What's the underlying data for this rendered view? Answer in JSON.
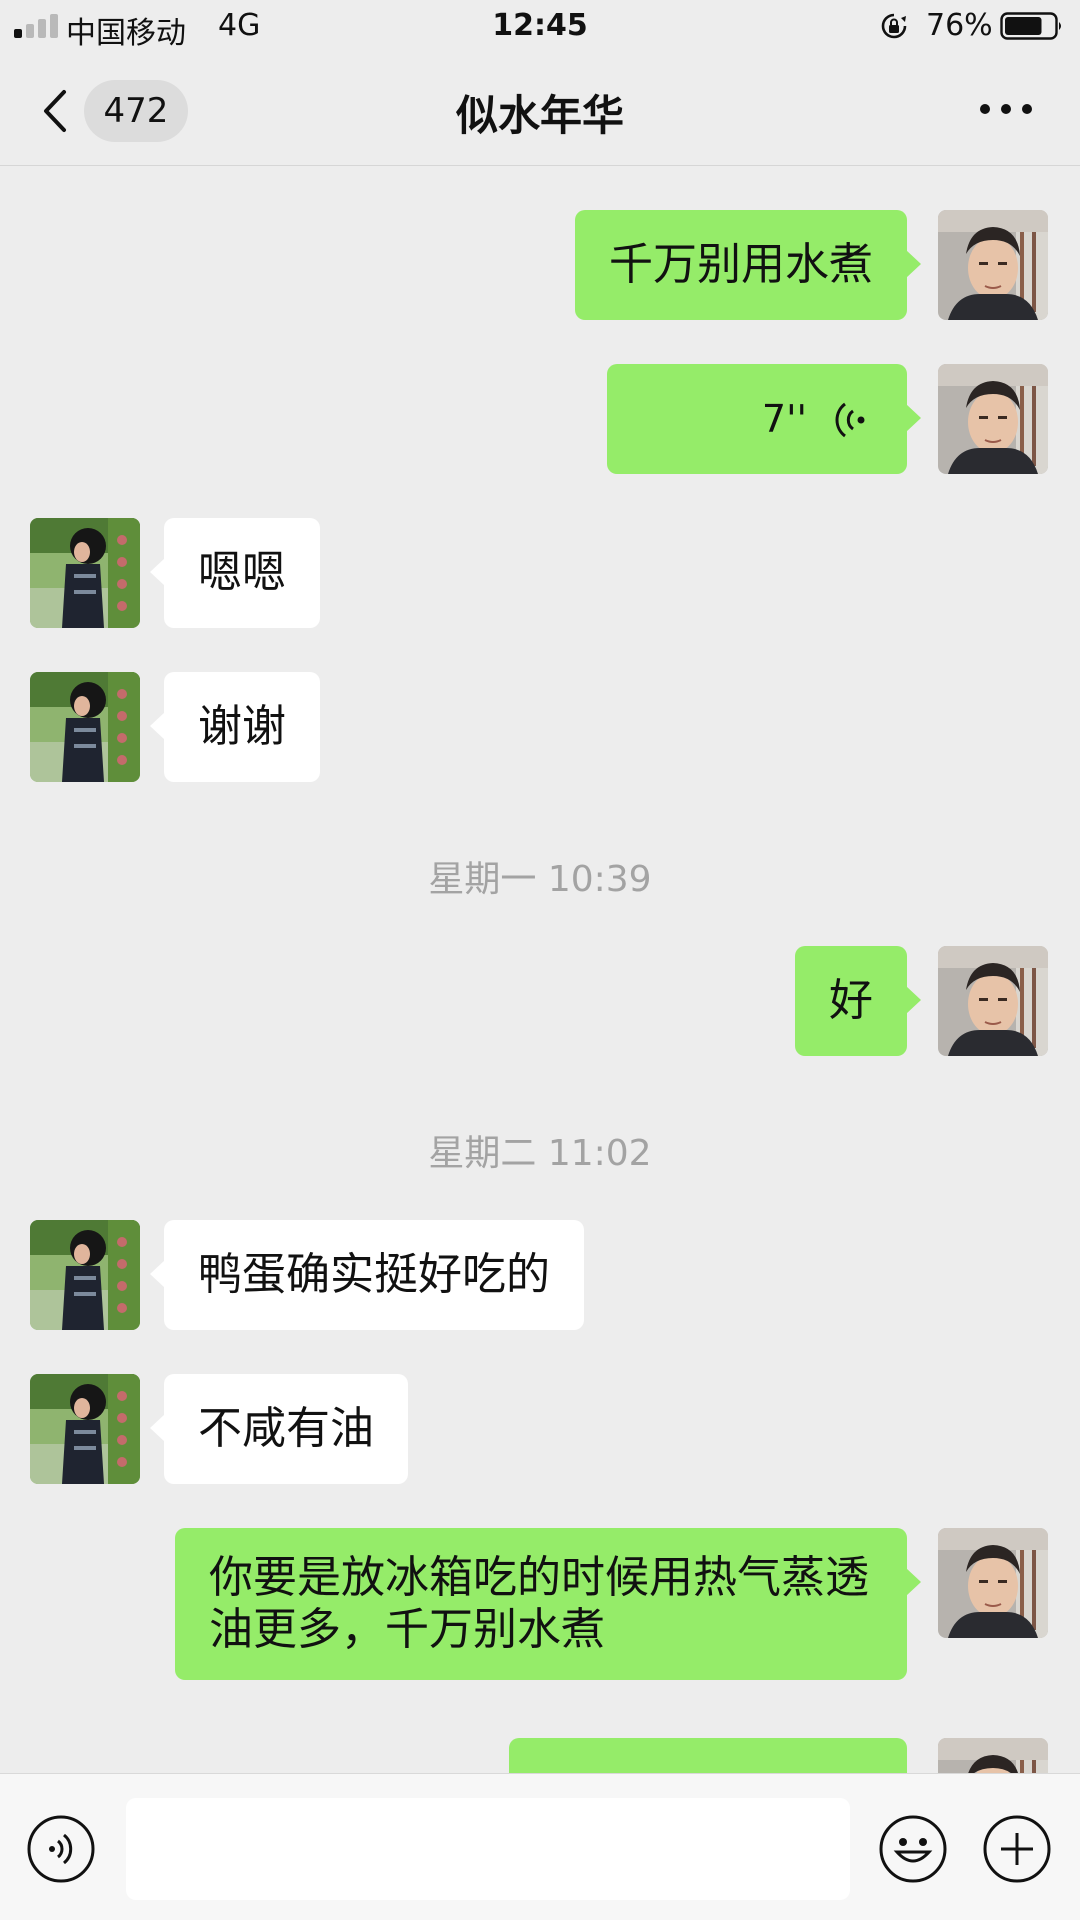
{
  "status_bar": {
    "carrier": "中国移动",
    "network": "4G",
    "time": "12:45",
    "battery_percent": "76%",
    "battery_level": 0.76,
    "icons": [
      "signal-icon",
      "rotation-lock-icon",
      "battery-icon"
    ]
  },
  "nav": {
    "unread_count": "472",
    "title": "似水年华",
    "icons": [
      "back-icon",
      "more-icon"
    ]
  },
  "messages": [
    {
      "side": "right",
      "type": "text",
      "text": "千万别用水煮"
    },
    {
      "side": "right",
      "type": "voice",
      "duration": "7''",
      "icon": "voice-wave-icon"
    },
    {
      "side": "left",
      "type": "text",
      "text": "嗯嗯"
    },
    {
      "side": "left",
      "type": "text",
      "text": "谢谢"
    },
    {
      "type": "timestamp",
      "text": "星期一 10:39"
    },
    {
      "side": "right",
      "type": "text",
      "text": "好"
    },
    {
      "type": "timestamp",
      "text": "星期二 11:02"
    },
    {
      "side": "left",
      "type": "text",
      "text": "鸭蛋确实挺好吃的"
    },
    {
      "side": "left",
      "type": "text",
      "text": "不咸有油"
    },
    {
      "side": "right",
      "type": "text",
      "text": "你要是放冰箱吃的时候用热气蒸透油更多，千万别水煮"
    },
    {
      "side": "right",
      "type": "text",
      "text": ""
    }
  ],
  "input_bar": {
    "value": "",
    "placeholder": "",
    "icons": [
      "voice-toggle-icon",
      "emoji-icon",
      "plus-icon"
    ]
  },
  "colors": {
    "background": "#ededed",
    "outgoing_bubble": "#95ec69",
    "incoming_bubble": "#ffffff",
    "timestamp_text": "#a3a3a3",
    "input_bar": "#f7f7f7"
  }
}
